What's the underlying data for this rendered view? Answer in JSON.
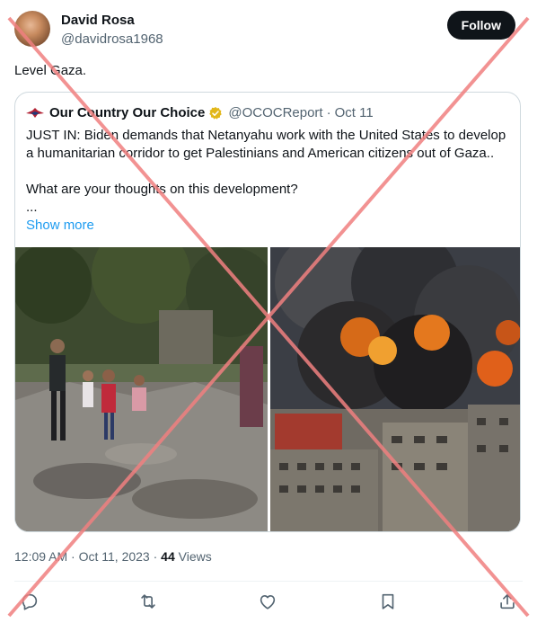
{
  "author": {
    "name": "David Rosa",
    "handle": "@davidrosa1968"
  },
  "follow_label": "Follow",
  "tweet_text": "Level Gaza.",
  "quoted": {
    "account_name": "Our Country Our Choice",
    "handle": "@OCOCReport",
    "separator": "·",
    "date": "Oct 11",
    "body_line1": "JUST IN: Biden demands that Netanyahu work with the United States to develop a humanitarian corridor to get Palestinians and American citizens out of Gaza..",
    "body_line2": "What are your thoughts on this development?",
    "ellipsis": "...",
    "show_more": "Show more"
  },
  "meta": {
    "time_date": "12:09 AM · Oct 11, 2023 · ",
    "views_count": "44",
    "views_label": " Views"
  },
  "icons": [
    "reply-icon",
    "retweet-icon",
    "like-icon",
    "bookmark-icon",
    "share-icon",
    "verified-badge-icon"
  ],
  "colors": {
    "follow_bg": "#0f1419",
    "link": "#1d9bf0",
    "verified": "#e2b719",
    "overlay_cross": "#f08080"
  }
}
